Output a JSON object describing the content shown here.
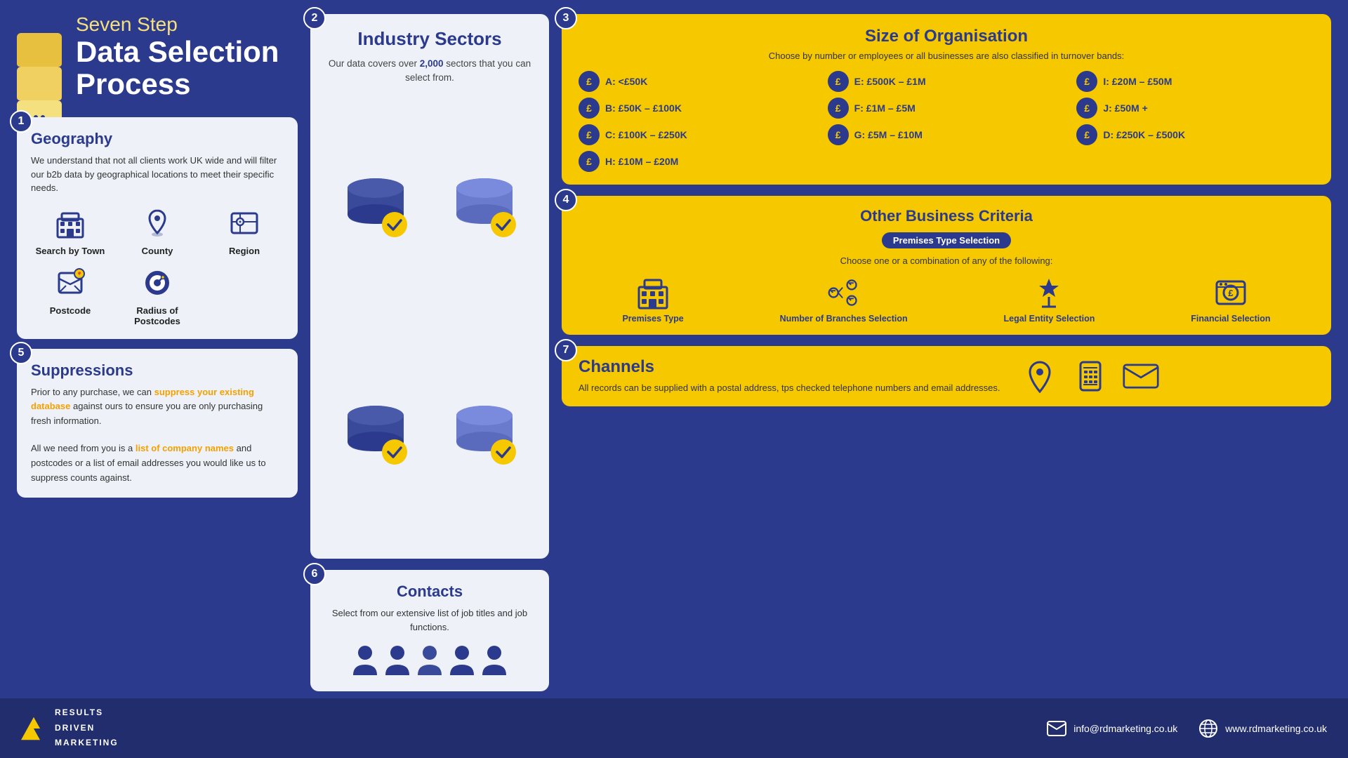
{
  "header": {
    "subtitle": "Seven Step",
    "title": "Data Selection Process"
  },
  "steps": {
    "s1": {
      "badge": "1",
      "title": "Geography",
      "description": "We understand that not all clients work UK wide and will filter our b2b data by geographical locations to meet their specific needs.",
      "items": [
        {
          "label": "Search by Town",
          "icon": "building"
        },
        {
          "label": "County",
          "icon": "map-marker"
        },
        {
          "label": "Region",
          "icon": "map-region"
        },
        {
          "label": "Postcode",
          "icon": "postcode"
        },
        {
          "label": "Radius of Postcodes",
          "icon": "radius"
        }
      ]
    },
    "s2": {
      "badge": "2",
      "title": "Industry Sectors",
      "description": "Our data covers over 2,000 sectors that you can select from.",
      "highlight": "2,000"
    },
    "s3": {
      "badge": "3",
      "title": "Size of Organisation",
      "subtitle": "Choose by number or employees or all businesses are also classified in turnover bands:",
      "bands": [
        {
          "label": "A: <£50K"
        },
        {
          "label": "B: £50K – £100K"
        },
        {
          "label": "C: £100K – £250K"
        },
        {
          "label": "D: £250K – £500K"
        },
        {
          "label": "E: £500K – £1M"
        },
        {
          "label": "F: £1M – £5M"
        },
        {
          "label": "G: £5M – £10M"
        },
        {
          "label": "H: £10M – £20M"
        },
        {
          "label": "I: £20M – £50M"
        },
        {
          "label": "J: £50M +"
        }
      ]
    },
    "s4": {
      "badge": "4",
      "title": "Other Business Criteria",
      "badge_label": "Premises Type Selection",
      "choose_text": "Choose one or a combination of any of the following:",
      "items": [
        {
          "label": "Premises Type",
          "icon": "building-icon"
        },
        {
          "label": "Number of Branches Selection",
          "icon": "branches-icon"
        },
        {
          "label": "Legal Entity Selection",
          "icon": "legal-icon"
        },
        {
          "label": "Financial Selection",
          "icon": "financial-icon"
        }
      ]
    },
    "s5": {
      "badge": "5",
      "title": "Suppressions",
      "description1": "Prior to any purchase, we can suppress your existing database against ours to ensure you are only purchasing fresh information.",
      "description2": "All we need from you is a list of company names and postcodes or a list of email addresses you would like us to suppress counts against.",
      "highlight1": "suppress your existing database",
      "highlight2": "list of company names"
    },
    "s6": {
      "badge": "6",
      "title": "Contacts",
      "description": "Select from our extensive list of job titles and job functions."
    },
    "s7": {
      "badge": "7",
      "title": "Channels",
      "description": "All records can be supplied with a postal address, tps checked telephone numbers and email addresses."
    }
  },
  "footer": {
    "logo_line1": "RESULTS",
    "logo_line2": "DRIVEN",
    "logo_line3": "MARKETING",
    "email": "info@rdmarketing.co.uk",
    "website": "www.rdmarketing.co.uk"
  }
}
